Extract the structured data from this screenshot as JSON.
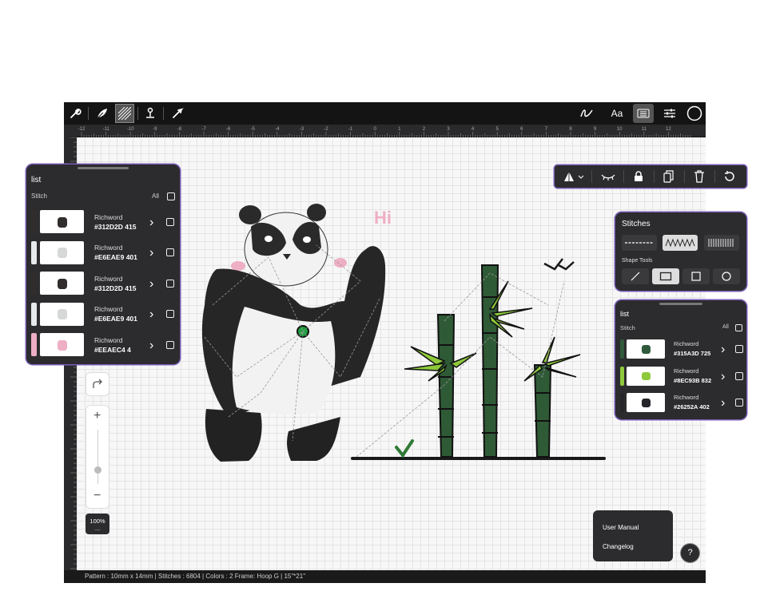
{
  "app": {
    "toolbar_left": [
      "wrench-icon",
      "leaf-icon",
      "hatch-fill-icon",
      "anchor-point-icon",
      "arrow-pointer-icon"
    ],
    "toolbar_right": [
      "curve-icon",
      "text-icon",
      "keyboard-icon",
      "sliders-icon",
      "circle-color-icon"
    ],
    "toolbar_text_label": "Aa"
  },
  "ruler": {
    "h_ticks": [
      "-12",
      "-11",
      "-10",
      "-9",
      "-8",
      "-7",
      "-6",
      "-5",
      "-4",
      "-3",
      "-2",
      "-1",
      "0",
      "1",
      "2",
      "3",
      "4",
      "5",
      "6",
      "7",
      "8",
      "9",
      "10",
      "11",
      "12"
    ]
  },
  "left_panel": {
    "title": "list",
    "subtitle": "Stitch",
    "all_label": "All",
    "items": [
      {
        "name": "Richword",
        "code": "#312D2D 415",
        "color": "#312d2d"
      },
      {
        "name": "Richword",
        "code": "#E6EAE9 401",
        "color": "#e6eae9"
      },
      {
        "name": "Richword",
        "code": "#312D2D 415",
        "color": "#312d2d"
      },
      {
        "name": "Richword",
        "code": "#E6EAE9 401",
        "color": "#e6eae9"
      },
      {
        "name": "Richword",
        "code": "#EEAEC4 4",
        "color": "#eeaec4"
      }
    ]
  },
  "stitches_panel": {
    "title": "Stitches",
    "shape_tools_label": "Shape Tools"
  },
  "right_panel": {
    "title": "list",
    "subtitle": "Stitch",
    "all_label": "All",
    "items": [
      {
        "name": "Richword",
        "code": "#315A3D 725",
        "color": "#315a3d"
      },
      {
        "name": "Richword",
        "code": "#8EC93B 832",
        "color": "#8ec93b"
      },
      {
        "name": "Richword",
        "code": "#26252A 402",
        "color": "#26252a"
      }
    ]
  },
  "zoom": {
    "level": "100%",
    "more": "..."
  },
  "help": {
    "user_manual": "User Manual",
    "changelog": "Changelog",
    "button": "?"
  },
  "status": {
    "text": "Pattern : 10mm x 14mm | Stitches : 6804 | Colors : 2    Frame: Hoop G | 15\"*21\""
  },
  "design_text": "Hi",
  "colors": {
    "accent": "#7a5fb8",
    "panel": "#2c2c2e",
    "bamboo": "#2f5a36",
    "leaf": "#8ec93b",
    "pink": "#eeaec4"
  }
}
